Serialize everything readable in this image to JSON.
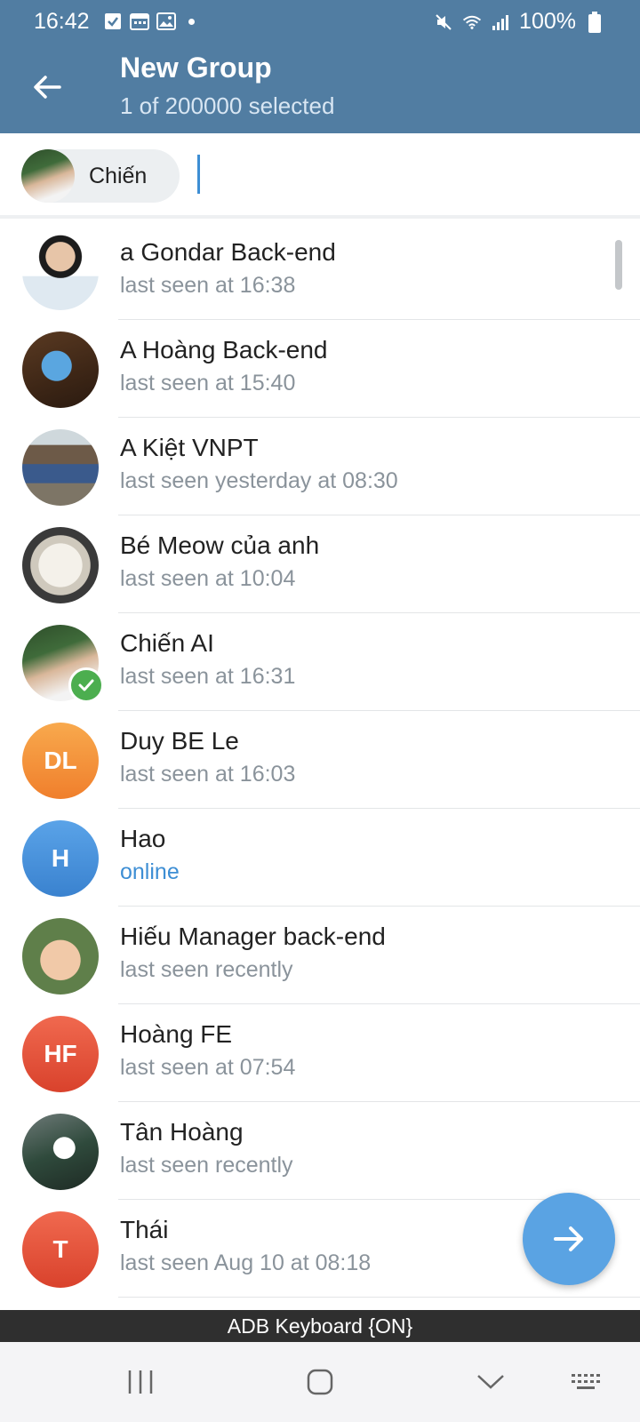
{
  "status_bar": {
    "time": "16:42",
    "battery": "100%"
  },
  "header": {
    "title": "New Group",
    "subtitle": "1 of 200000 selected"
  },
  "chip": {
    "label": "Chiến"
  },
  "contacts": [
    {
      "name": "a Gondar Back-end",
      "status": "last seen at 16:38",
      "avatar_type": "photo"
    },
    {
      "name": "A Hoàng Back-end",
      "status": "last seen at 15:40",
      "avatar_type": "photo"
    },
    {
      "name": "A Kiệt VNPT",
      "status": "last seen yesterday at 08:30",
      "avatar_type": "photo"
    },
    {
      "name": "Bé Meow của anh",
      "status": "last seen at 10:04",
      "avatar_type": "photo"
    },
    {
      "name": "Chiến AI",
      "status": "last seen at 16:31",
      "avatar_type": "photo",
      "selected": true
    },
    {
      "name": "Duy BE Le",
      "status": "last seen at 16:03",
      "initials": "DL",
      "color": "#f4913b"
    },
    {
      "name": "Hao",
      "status": "online",
      "initials": "H",
      "color": "#3d8ed4"
    },
    {
      "name": "Hiếu Manager back-end",
      "status": "last seen recently",
      "avatar_type": "photo"
    },
    {
      "name": "Hoàng FE",
      "status": "last seen at 07:54",
      "initials": "HF",
      "color": "#e5533d"
    },
    {
      "name": "Tân Hoàng",
      "status": "last seen recently",
      "avatar_type": "photo"
    },
    {
      "name": "Thái",
      "status": "last seen Aug 10 at 08:18",
      "initials": "T",
      "color": "#e5533d"
    }
  ],
  "keyboard_banner": "ADB Keyboard {ON}",
  "colors": {
    "header": "#517da2",
    "accent": "#3d8ed4",
    "fab": "#5aa3e3",
    "selected_badge": "#4cae4f"
  },
  "icons": {
    "back": "arrow-left-icon",
    "fab": "arrow-right-icon",
    "selected": "check-icon"
  }
}
